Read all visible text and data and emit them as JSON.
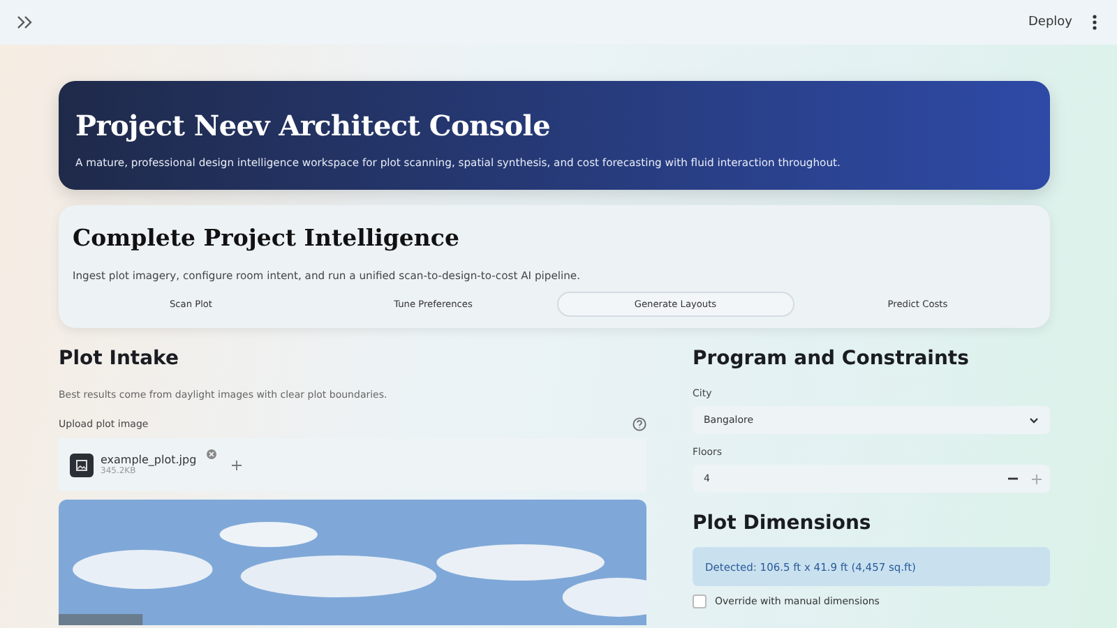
{
  "header": {
    "deploy": "Deploy"
  },
  "hero": {
    "title": "Project Neev Architect Console",
    "subtitle": "A mature, professional design intelligence workspace for plot scanning, spatial synthesis, and cost forecasting with fluid interaction throughout."
  },
  "overview": {
    "title": "Complete Project Intelligence",
    "description": "Ingest plot imagery, configure room intent, and run a unified scan-to-design-to-cost AI pipeline.",
    "tabs": [
      {
        "label": "Scan Plot",
        "selected": false
      },
      {
        "label": "Tune Preferences",
        "selected": false
      },
      {
        "label": "Generate Layouts",
        "selected": true
      },
      {
        "label": "Predict Costs",
        "selected": false
      }
    ]
  },
  "plot_intake": {
    "title": "Plot Intake",
    "hint": "Best results come from daylight images with clear plot boundaries.",
    "upload_label": "Upload plot image",
    "file": {
      "name": "example_plot.jpg",
      "size": "345.2KB"
    }
  },
  "program": {
    "title": "Program and Constraints",
    "city_label": "City",
    "city": "Bangalore",
    "floors_label": "Floors",
    "floors": "4"
  },
  "plot_dimensions": {
    "title": "Plot Dimensions",
    "detected": "Detected: 106.5 ft x 41.9 ft (4,457 sq.ft)",
    "override": {
      "label": "Override with manual dimensions",
      "checked": false
    }
  }
}
